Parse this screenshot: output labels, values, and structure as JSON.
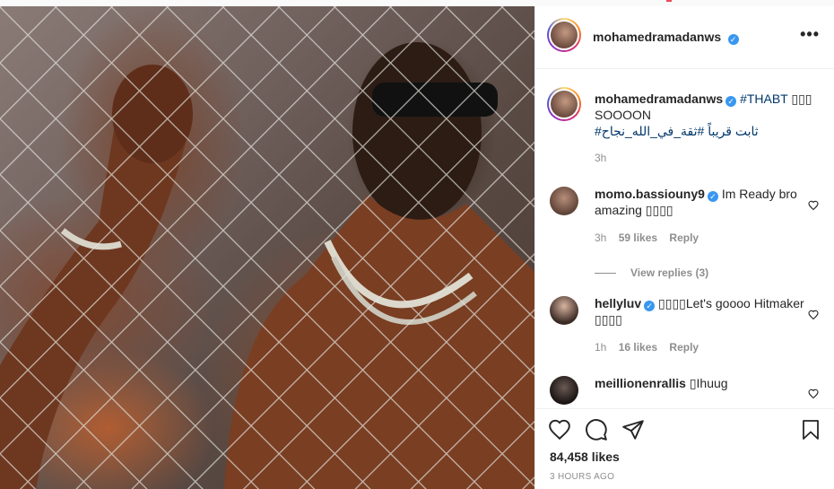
{
  "post": {
    "username": "mohamedramadanws",
    "caption_hashtag": "#THABT",
    "caption_emoji": "▯▯▯",
    "caption_line2": "SOOOON",
    "caption_arabic": "ثابت قريباً #ثقة_في_الله_نجاح#",
    "caption_time": "3h",
    "likes": "84,458 likes",
    "posted": "3 HOURS AGO"
  },
  "comments": [
    {
      "username": "momo.bassiouny9",
      "text": "Im Ready bro amazing ▯▯▯▯",
      "time": "3h",
      "likes": "59 likes",
      "reply": "Reply",
      "verified": true
    },
    {
      "username": "hellyluv",
      "text": "▯▯▯▯Let's goooo Hitmaker ▯▯▯▯",
      "time": "1h",
      "likes": "16 likes",
      "reply": "Reply",
      "verified": true
    },
    {
      "username": "meillionenrallis",
      "text": "▯Ihuug",
      "verified": false
    }
  ],
  "view_replies": "View replies (3)",
  "icons": [
    "more-options-icon",
    "verified-badge-icon",
    "heart-icon",
    "comment-icon",
    "share-icon",
    "bookmark-icon"
  ],
  "colors": {
    "verified": "#3897f0",
    "link": "#00376b",
    "meta": "#8e8e8e",
    "border": "#efefef"
  }
}
